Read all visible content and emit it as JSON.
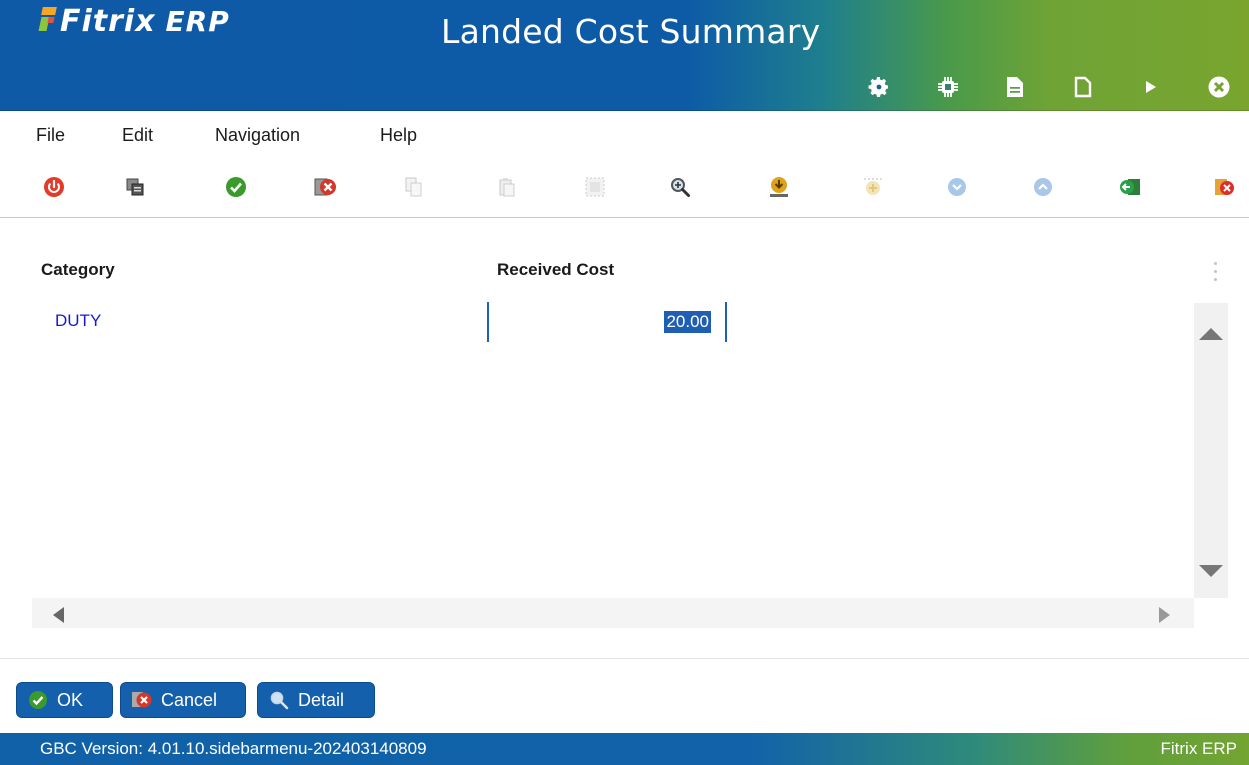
{
  "header": {
    "logo_text": "Fitrix",
    "logo_suffix": "ERP",
    "title": "Landed Cost Summary",
    "icons": [
      "gear-icon",
      "chip-icon",
      "document-icon",
      "new-document-icon",
      "play-icon",
      "close-circle-icon"
    ]
  },
  "menu": {
    "items": [
      "File",
      "Edit",
      "Navigation",
      "Help"
    ]
  },
  "toolbar": {
    "icons": [
      "power-icon",
      "copy-window-icon",
      "accept-icon",
      "cancel-icon",
      "copy-icon",
      "paste-icon",
      "select-all-icon",
      "zoom-icon",
      "download-icon",
      "add-icon",
      "scroll-down-icon",
      "scroll-up-icon",
      "previous-record-icon",
      "next-record-icon"
    ]
  },
  "grid": {
    "columns": [
      "Category",
      "Received Cost"
    ],
    "rows": [
      {
        "category": "DUTY",
        "received_cost": "20.00"
      }
    ]
  },
  "buttons": {
    "ok": "OK",
    "cancel": "Cancel",
    "detail": "Detail"
  },
  "status": {
    "version": "GBC Version: 4.01.10.sidebarmenu-202403140809",
    "product": "Fitrix ERP"
  },
  "colors": {
    "header_blue": "#0d5ba7",
    "header_green": "#79a52f",
    "link_blue": "#1a1acb",
    "selection_blue": "#1e5fb4",
    "button_blue": "#1560ad"
  }
}
